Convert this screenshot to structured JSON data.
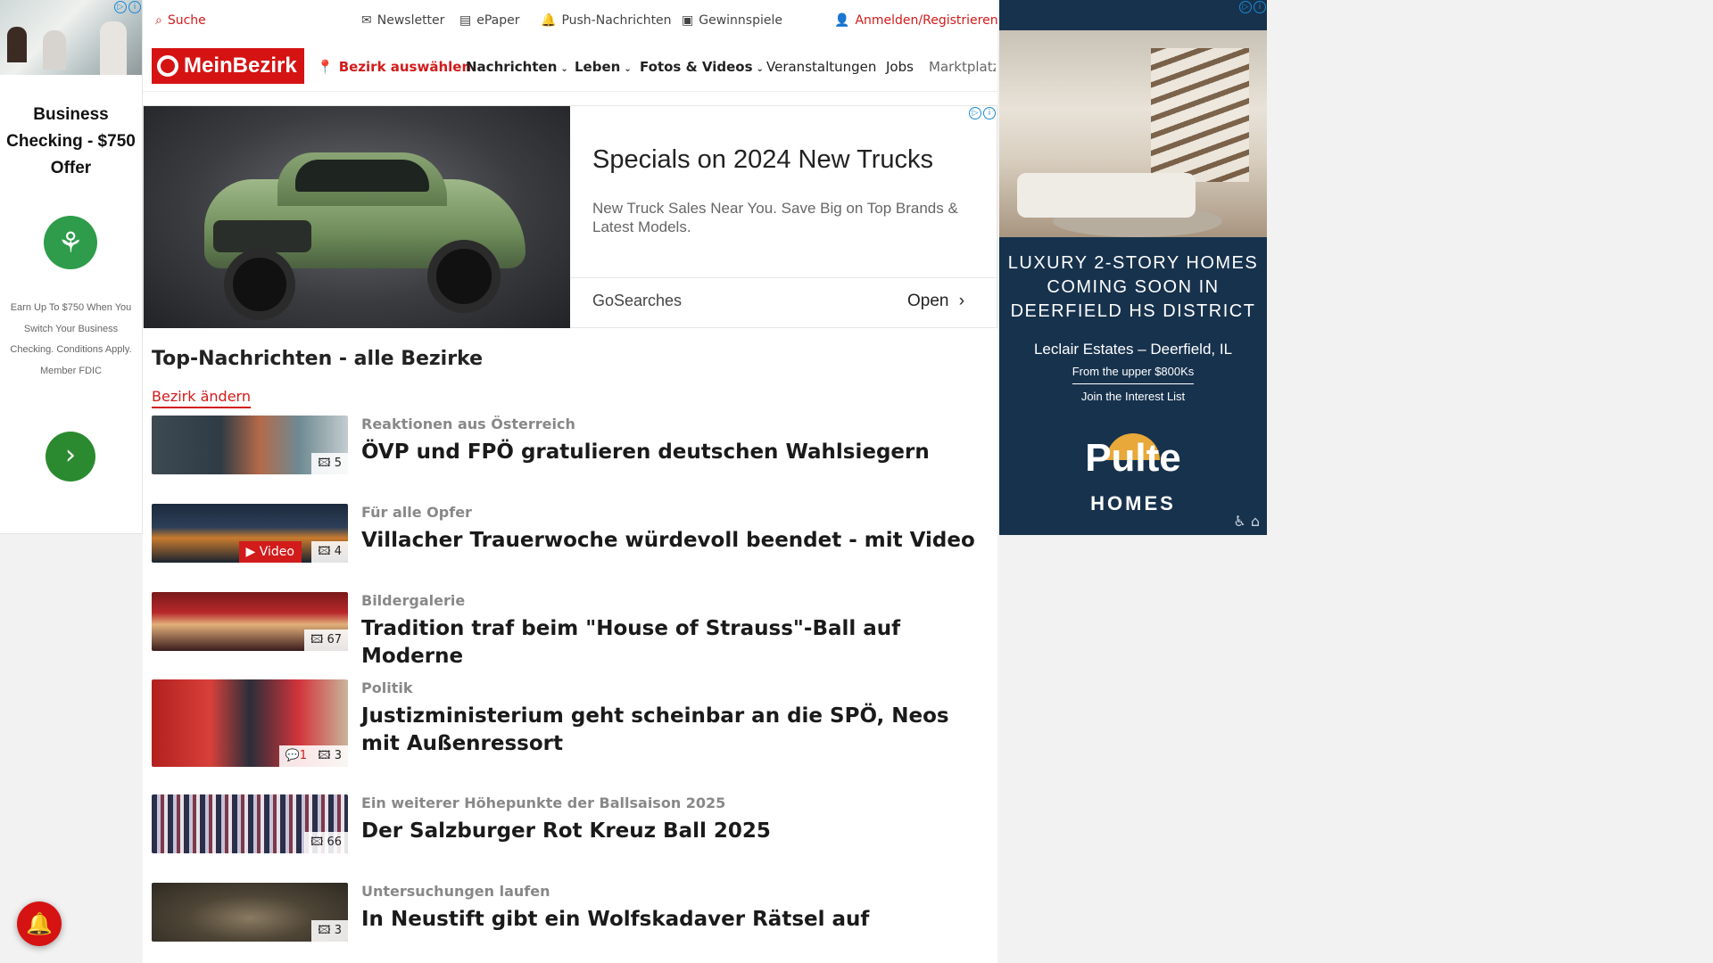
{
  "left_ad": {
    "ad_mark": "▷",
    "info_mark": "i",
    "title": "Business Checking - $750 Offer",
    "logo_glyph": "⚘",
    "body": "Earn Up To $750 When You Switch Your Business Checking. Conditions Apply. Member FDIC",
    "cta_glyph": "›"
  },
  "utility_bar": {
    "search": "Suche",
    "newsletter": "Newsletter",
    "epaper": "ePaper",
    "push": "Push-Nachrichten",
    "contests": "Gewinnspiele",
    "login": "Anmelden/Registrieren",
    "icons": {
      "search": "⌕",
      "newsletter": "✉",
      "epaper": "▤",
      "push": "🔔",
      "contests": "▣",
      "login": "👤"
    }
  },
  "nav": {
    "logo": "MeinBezirk",
    "district_icon": "📍",
    "district": "Bezirk auswählen",
    "items": [
      {
        "label": "Nachrichten",
        "chevron": "⌄"
      },
      {
        "label": "Leben",
        "chevron": "⌄"
      },
      {
        "label": "Fotos & Videos",
        "chevron": "⌄"
      },
      {
        "label": "Veranstaltungen",
        "chevron": ""
      },
      {
        "label": "Jobs",
        "chevron": ""
      },
      {
        "label": "Marktplatz",
        "chevron": ""
      }
    ]
  },
  "truck_ad": {
    "headline": "Specials on 2024 New Trucks",
    "description": "New Truck Sales Near You. Save Big on Top Brands & Latest Models.",
    "source": "GoSearches",
    "cta": "Open",
    "cta_icon": "›",
    "ad_mark": "▷",
    "info_mark": "i"
  },
  "section": {
    "title": "Top-Nachrichten - alle Bezirke",
    "change_link": "Bezirk ändern"
  },
  "articles": [
    {
      "kicker": "Reaktionen aus Österreich",
      "headline": "ÖVP und FPÖ gratulieren deutschen Wahlsiegern",
      "photo_icon": "🖾",
      "photos": "5",
      "comments": "",
      "video": ""
    },
    {
      "kicker": "Für alle Opfer",
      "headline": "Villacher Trauerwoche würdevoll beendet - mit Video",
      "photo_icon": "🖾",
      "photos": "4",
      "comments": "",
      "video": "Video",
      "video_icon": "▶"
    },
    {
      "kicker": "Bildergalerie",
      "headline": "Tradition traf beim \"House of Strauss\"-Ball auf Moderne",
      "photo_icon": "🖾",
      "photos": "67",
      "comments": "",
      "video": ""
    },
    {
      "kicker": "Politik",
      "headline": "Justizministerium geht scheinbar an die SPÖ, Neos mit Außenressort",
      "photo_icon": "🖾",
      "photos": "3",
      "comments": "1",
      "comment_icon": "💬",
      "video": ""
    },
    {
      "kicker": "Ein weiterer Höhepunkte der Ballsaison 2025",
      "headline": "Der Salzburger Rot Kreuz Ball 2025",
      "photo_icon": "🖾",
      "photos": "66",
      "comments": "",
      "video": ""
    },
    {
      "kicker": "Untersuchungen laufen",
      "headline": "In Neustift gibt ein Wolfskadaver Rätsel auf",
      "photo_icon": "🖾",
      "photos": "3",
      "comments": "",
      "video": ""
    }
  ],
  "right_ad": {
    "headline": "LUXURY 2-STORY HOMES COMING SOON IN DEERFIELD HS DISTRICT",
    "location": "Leclair Estates – Deerfield, IL",
    "price": "From the upper $800Ks",
    "cta": "Join the Interest List",
    "brand": "Pulte",
    "brand_sub": "HOMES",
    "access_icons": "♿ ⌂",
    "ad_mark": "▷",
    "info_mark": "i"
  },
  "bell_icon": "🔔"
}
